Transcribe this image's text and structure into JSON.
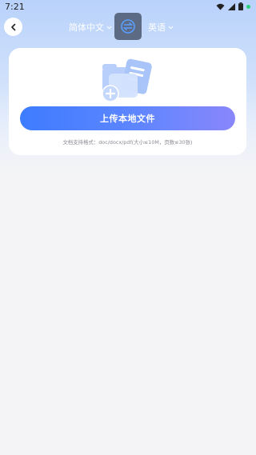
{
  "status_bar": {
    "time": "7:21",
    "icons": [
      "wifi-icon",
      "signal-icon",
      "battery-icon",
      "notification-dot"
    ]
  },
  "header": {
    "back_icon": "back-icon",
    "source_language": "简体中文",
    "target_language": "英语",
    "swap_icon": "swap-languages-icon"
  },
  "card": {
    "illustration_icon": "document-add-icon",
    "upload_label": "上传本地文件",
    "hint": "文档支持格式：doc/docx/pdf(大小≤10M，页数≤30张)"
  },
  "colors": {
    "accent_start": "#3d7cff",
    "accent_end": "#8a86fb",
    "header_gradient": "#b9d2fb"
  }
}
